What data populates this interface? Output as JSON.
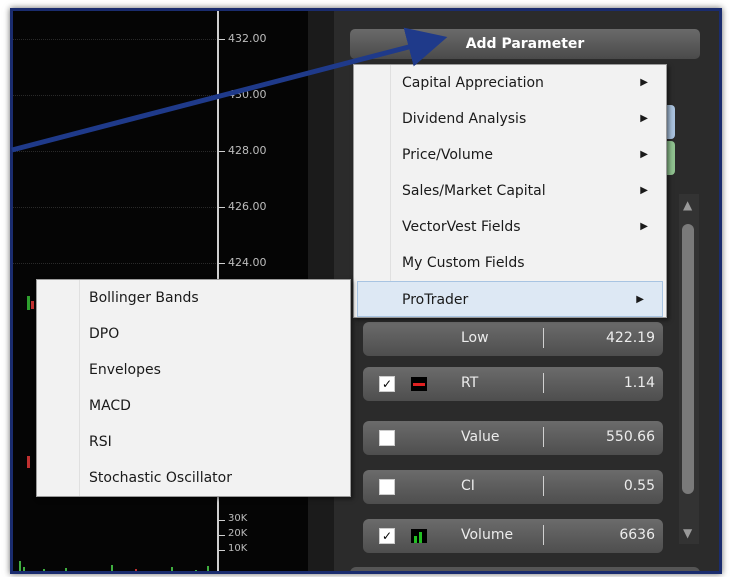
{
  "chart": {
    "price_ticks": [
      "432.00",
      "430.00",
      "428.00",
      "426.00",
      "424.00"
    ],
    "volume_ticks": [
      "30K",
      "20K",
      "10K"
    ]
  },
  "panel": {
    "add_parameter_label": "Add Parameter",
    "rows": [
      {
        "name": "Low",
        "value": "422.19",
        "checked": false,
        "swatch": "none"
      },
      {
        "name": "RT",
        "value": "1.14",
        "checked": true,
        "swatch": "red-line"
      },
      {
        "name": "Value",
        "value": "550.66",
        "checked": false,
        "swatch": "none"
      },
      {
        "name": "CI",
        "value": "0.55",
        "checked": false,
        "swatch": "none"
      },
      {
        "name": "Volume",
        "value": "6636",
        "checked": true,
        "swatch": "green-bars"
      }
    ],
    "check_mark": "✓",
    "scroll_up": "▲",
    "scroll_down": "▼"
  },
  "menu": {
    "items": [
      {
        "label": "Capital Appreciation",
        "has_submenu": true
      },
      {
        "label": "Dividend Analysis",
        "has_submenu": true
      },
      {
        "label": "Price/Volume",
        "has_submenu": true
      },
      {
        "label": "Sales/Market Capital",
        "has_submenu": true
      },
      {
        "label": "VectorVest Fields",
        "has_submenu": true
      },
      {
        "label": "My Custom Fields",
        "has_submenu": false
      },
      {
        "label": "ProTrader",
        "has_submenu": true
      }
    ],
    "arrow_glyph": "▶"
  },
  "submenu": {
    "items": [
      "Bollinger Bands",
      "DPO",
      "Envelopes",
      "MACD",
      "RSI",
      "Stochastic Oscillator"
    ]
  },
  "colors": {
    "frame_border": "#1a2c6e",
    "annotation_arrow": "#1f3a8a",
    "highlight": "#dde8f4"
  }
}
